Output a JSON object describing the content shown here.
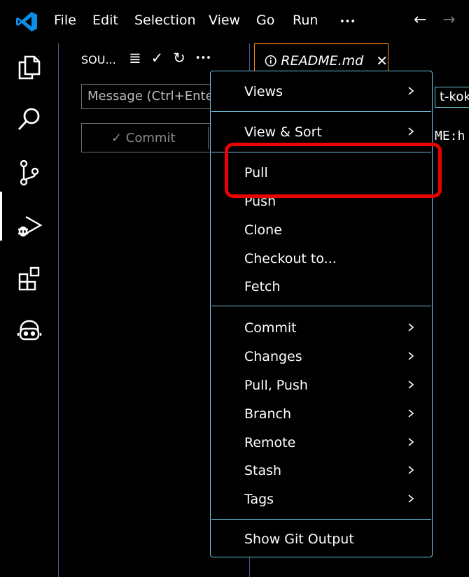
{
  "titlebar": {
    "menu": [
      "File",
      "Edit",
      "Selection",
      "View",
      "Go",
      "Run",
      "•••"
    ],
    "nav_back": "←",
    "nav_forward": "→"
  },
  "activitybar": {
    "icons": [
      "explorer-icon",
      "search-icon",
      "source-control-icon",
      "run-debug-icon",
      "extensions-icon",
      "copilot-icon"
    ]
  },
  "sidebar": {
    "title": "SOU...",
    "actions": [
      "≣",
      "✓",
      "↻",
      "•••"
    ],
    "message_text": "Message (Ctrl+Ente",
    "commit_label": "✓ Commit"
  },
  "editor": {
    "tab_label": "README.md",
    "tab_close": "✕",
    "partial_text_1": "t-koke",
    "partial_text_2": "ME:h"
  },
  "context_menu": {
    "group1": [
      {
        "label": "Views",
        "submenu": true
      }
    ],
    "group2": [
      {
        "label": "View & Sort",
        "submenu": true
      }
    ],
    "group3": [
      {
        "label": "Pull",
        "submenu": false
      },
      {
        "label": "Push",
        "submenu": false
      },
      {
        "label": "Clone",
        "submenu": false
      },
      {
        "label": "Checkout to...",
        "submenu": false
      },
      {
        "label": "Fetch",
        "submenu": false
      }
    ],
    "group4": [
      {
        "label": "Commit",
        "submenu": true
      },
      {
        "label": "Changes",
        "submenu": true
      },
      {
        "label": "Pull, Push",
        "submenu": true
      },
      {
        "label": "Branch",
        "submenu": true
      },
      {
        "label": "Remote",
        "submenu": true
      },
      {
        "label": "Stash",
        "submenu": true
      },
      {
        "label": "Tags",
        "submenu": true
      }
    ],
    "group5": [
      {
        "label": "Show Git Output",
        "submenu": false
      }
    ]
  },
  "colors": {
    "background": "#000000",
    "contrast_border": "#6fc3df",
    "active_tab_border": "#f38518",
    "highlight": "#ea0000",
    "vscode_blue": "#0078d4"
  }
}
